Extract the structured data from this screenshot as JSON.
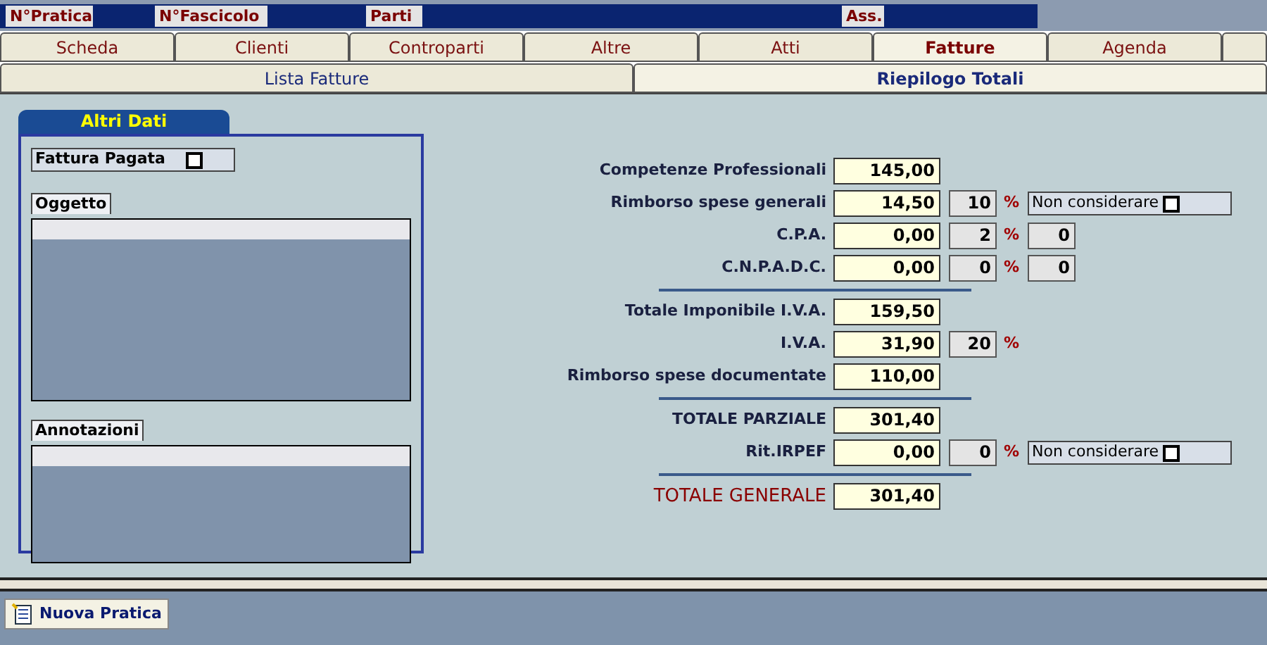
{
  "header_fields": [
    {
      "label": "N°Pratica"
    },
    {
      "label": "N°Fascicolo"
    },
    {
      "label": "Parti"
    },
    {
      "label": "Ass."
    }
  ],
  "tabs": [
    {
      "label": "Scheda",
      "selected": false
    },
    {
      "label": "Clienti",
      "selected": false
    },
    {
      "label": "Controparti",
      "selected": false
    },
    {
      "label": "Altre",
      "selected": false
    },
    {
      "label": "Atti",
      "selected": false
    },
    {
      "label": "Fatture",
      "selected": true
    },
    {
      "label": "Agenda",
      "selected": false
    }
  ],
  "subtabs": [
    {
      "label": "Lista Fatture",
      "selected": false
    },
    {
      "label": "Riepilogo Totali",
      "selected": true
    }
  ],
  "altri_dati": {
    "title": "Altri Dati",
    "fattura_pagata": {
      "label": "Fattura Pagata",
      "checked": false
    },
    "oggetto": {
      "label": "Oggetto"
    },
    "annotazioni": {
      "label": "Annotazioni"
    }
  },
  "totals": [
    {
      "kind": "row",
      "label": "Competenze Professionali",
      "value": "145,00"
    },
    {
      "kind": "row",
      "label": "Rimborso spese generali",
      "value": "14,50",
      "percent": "10",
      "percent_sign": "%",
      "exclude": {
        "label": "Non considerare",
        "checked": false
      }
    },
    {
      "kind": "row",
      "label": "C.P.A.",
      "value": "0,00",
      "percent": "2",
      "percent_sign": "%",
      "extra": "0"
    },
    {
      "kind": "row",
      "label": "C.N.P.A.D.C.",
      "value": "0,00",
      "percent": "0",
      "percent_sign": "%",
      "extra": "0"
    },
    {
      "kind": "divider"
    },
    {
      "kind": "row",
      "label": "Totale Imponibile I.V.A.",
      "value": "159,50"
    },
    {
      "kind": "row",
      "label": "I.V.A.",
      "value": "31,90",
      "percent": "20",
      "percent_sign": "%"
    },
    {
      "kind": "row",
      "label": "Rimborso spese documentate",
      "value": "110,00"
    },
    {
      "kind": "divider"
    },
    {
      "kind": "row",
      "label": "TOTALE PARZIALE",
      "value": "301,40"
    },
    {
      "kind": "row",
      "label": "Rit.IRPEF",
      "value": "0,00",
      "percent": "0",
      "percent_sign": "%",
      "exclude": {
        "label": "Non considerare",
        "checked": false
      }
    },
    {
      "kind": "divider"
    },
    {
      "kind": "grand",
      "label": "TOTALE GENERALE",
      "value": "301,40"
    }
  ],
  "footer": {
    "button": "Nuova Pratica"
  }
}
